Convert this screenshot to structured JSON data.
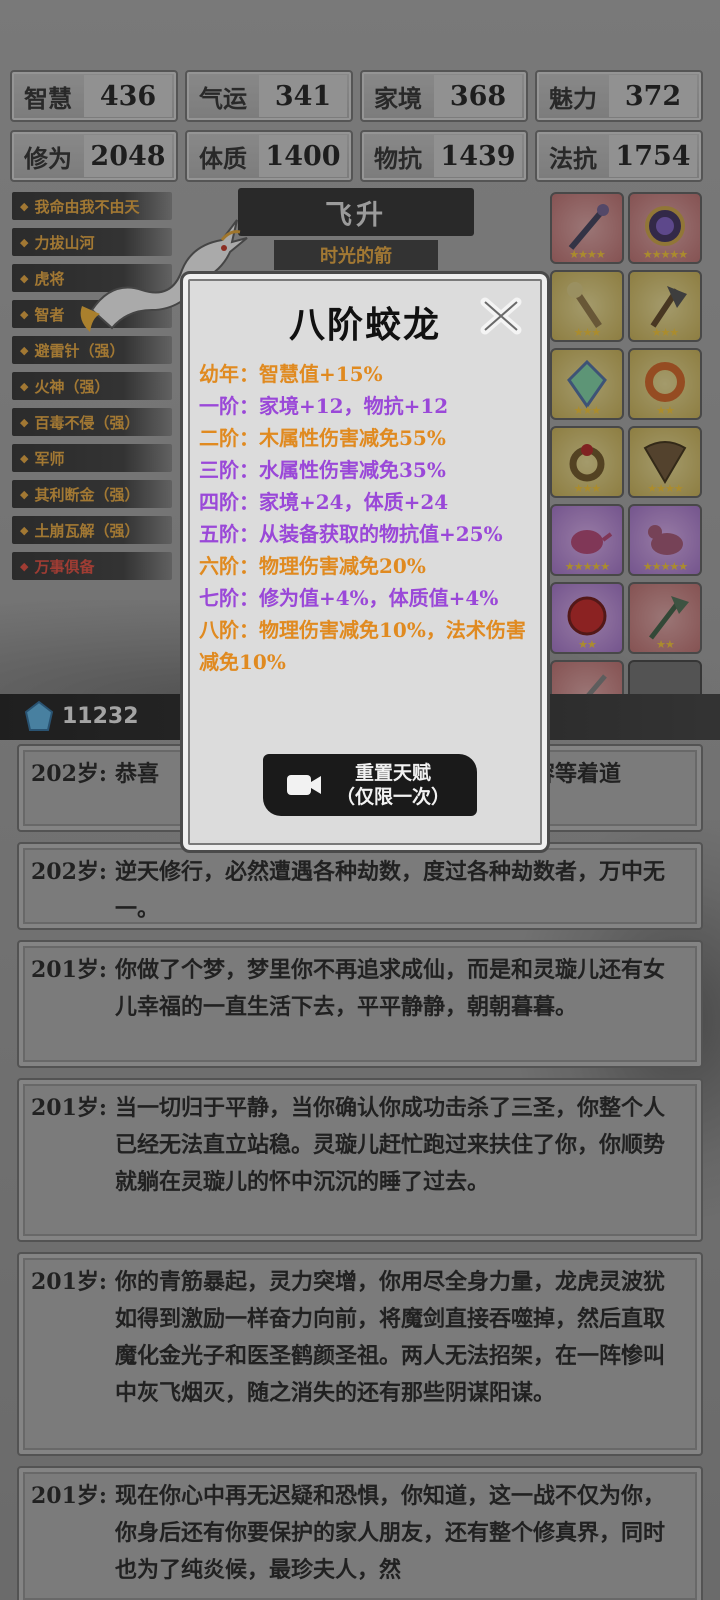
{
  "stats": [
    {
      "label": "智慧",
      "value": "436"
    },
    {
      "label": "气运",
      "value": "341"
    },
    {
      "label": "家境",
      "value": "368"
    },
    {
      "label": "魅力",
      "value": "372"
    },
    {
      "label": "修为",
      "value": "2048"
    },
    {
      "label": "体质",
      "value": "1400"
    },
    {
      "label": "物抗",
      "value": "1439"
    },
    {
      "label": "法抗",
      "value": "1754"
    }
  ],
  "talents": [
    {
      "label": "我命由我不由天",
      "color": "#e3a33a"
    },
    {
      "label": "力拔山河",
      "color": "#e3a33a"
    },
    {
      "label": "虎将",
      "color": "#e3a33a"
    },
    {
      "label": "智者",
      "color": "#e3a33a"
    },
    {
      "label": "避雷针（强）",
      "color": "#e3a33a"
    },
    {
      "label": "火神（强）",
      "color": "#e3a33a"
    },
    {
      "label": "百毒不侵（强）",
      "color": "#e3a33a"
    },
    {
      "label": "军师",
      "color": "#e3a33a"
    },
    {
      "label": "其利断金（强）",
      "color": "#e3a33a"
    },
    {
      "label": "土崩瓦解（强）",
      "color": "#e3a33a"
    },
    {
      "label": "万事俱备",
      "color": "#e0483a"
    }
  ],
  "ascension": {
    "title": "飞升",
    "subtitle": "时光的箭"
  },
  "items": [
    {
      "name": "staff",
      "rarity": "red",
      "stars": 4
    },
    {
      "name": "mirror",
      "rarity": "red",
      "stars": 5
    },
    {
      "name": "scepter",
      "rarity": "gold",
      "stars": 3
    },
    {
      "name": "axe",
      "rarity": "gold",
      "stars": 3
    },
    {
      "name": "crystal",
      "rarity": "gold",
      "stars": 3
    },
    {
      "name": "fire-ring",
      "rarity": "gold",
      "stars": 2
    },
    {
      "name": "ring",
      "rarity": "gold",
      "stars": 3
    },
    {
      "name": "fan",
      "rarity": "gold",
      "stars": 4
    },
    {
      "name": "teapot",
      "rarity": "purple",
      "stars": 5
    },
    {
      "name": "duck",
      "rarity": "purple",
      "stars": 5
    },
    {
      "name": "red-orb",
      "rarity": "purple",
      "stars": 2
    },
    {
      "name": "halberd",
      "rarity": "red",
      "stars": 2
    },
    {
      "name": "sword",
      "rarity": "red",
      "stars": 5
    },
    {
      "name": "empty",
      "rarity": "empty",
      "stars": 0
    }
  ],
  "spirit_stones": "11232",
  "modal": {
    "title": "八阶蛟龙",
    "tiers": [
      {
        "text": "幼年：智慧值+15%",
        "color": "o"
      },
      {
        "text": "一阶：家境+12，物抗+12",
        "color": "p"
      },
      {
        "text": "二阶：木属性伤害减免55%",
        "color": "o"
      },
      {
        "text": "三阶：水属性伤害减免35%",
        "color": "p"
      },
      {
        "text": "四阶：家境+24，体质+24",
        "color": "p"
      },
      {
        "text": "五阶：从装备获取的物抗值+25%",
        "color": "p"
      },
      {
        "text": "六阶：物理伤害减免20%",
        "color": "o"
      },
      {
        "text": "七阶：修为值+4%，体质值+4%",
        "color": "p"
      },
      {
        "text": "八阶：物理伤害减免10%，法术伤害减免10%",
        "color": "o"
      }
    ],
    "reset_line1": "重置天赋",
    "reset_line2": "（仅限一次）"
  },
  "log": [
    {
      "age": "202岁:",
      "text": "恭喜　　　　　　　　　　　　　　多的内容等着道"
    },
    {
      "age": "202岁:",
      "text": "逆天修行，必然遭遇各种劫数，度过各种劫数者，万中无一。"
    },
    {
      "age": "201岁:",
      "text": "你做了个梦，梦里你不再追求成仙，而是和灵璇儿还有女儿幸福的一直生活下去，平平静静，朝朝暮暮。"
    },
    {
      "age": "201岁:",
      "text": "当一切归于平静，当你确认你成功击杀了三圣，你整个人已经无法直立站稳。灵璇儿赶忙跑过来扶住了你，你顺势就躺在灵璇儿的怀中沉沉的睡了过去。"
    },
    {
      "age": "201岁:",
      "text": "你的青筋暴起，灵力突增，你用尽全身力量，龙虎灵波犹如得到激励一样奋力向前，将魔剑直接吞噬掉，然后直取魔化金光子和医圣鹤颜圣祖。两人无法招架，在一阵惨叫中灰飞烟灭，随之消失的还有那些阴谋阳谋。"
    },
    {
      "age": "201岁:",
      "text": "现在你心中再无迟疑和恐惧，你知道，这一战不仅为你，你身后还有你要保护的家人朋友，还有整个修真界，同时也为了纯炎候，最珍夫人，然"
    }
  ]
}
